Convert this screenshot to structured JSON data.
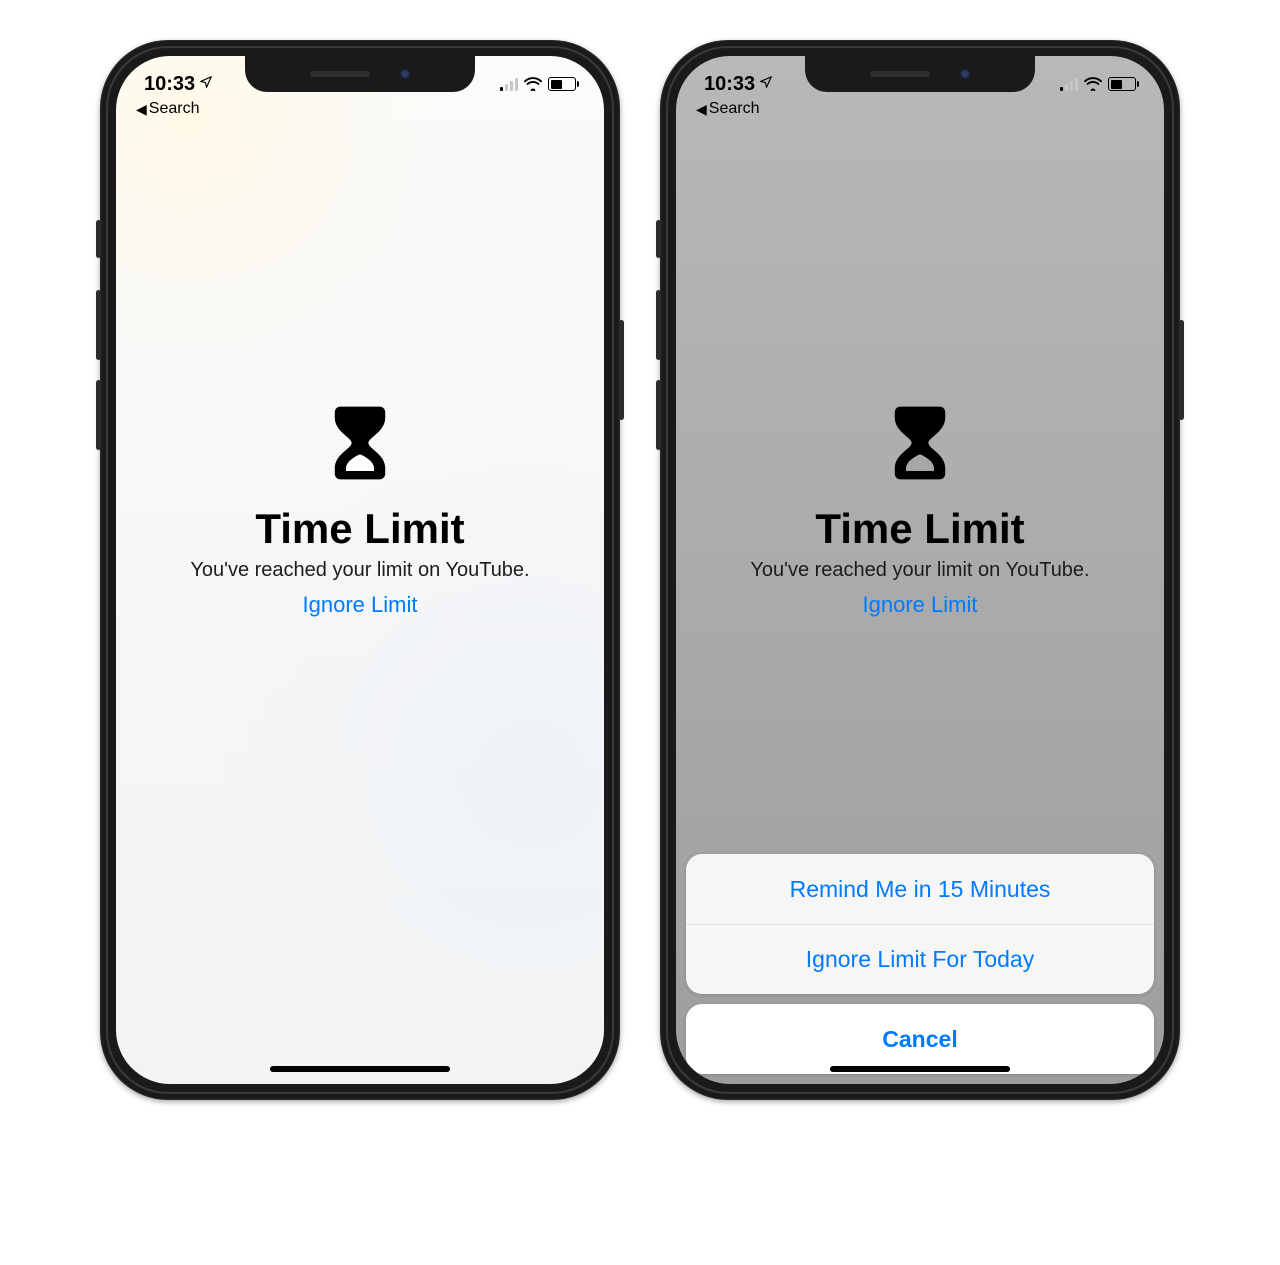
{
  "status": {
    "time": "10:33",
    "back_label": "Search"
  },
  "limit": {
    "title": "Time Limit",
    "subtitle": "You've reached your limit on YouTube.",
    "ignore_label": "Ignore Limit"
  },
  "sheet": {
    "option_remind": "Remind Me in 15 Minutes",
    "option_ignore_today": "Ignore Limit For Today",
    "cancel": "Cancel"
  }
}
